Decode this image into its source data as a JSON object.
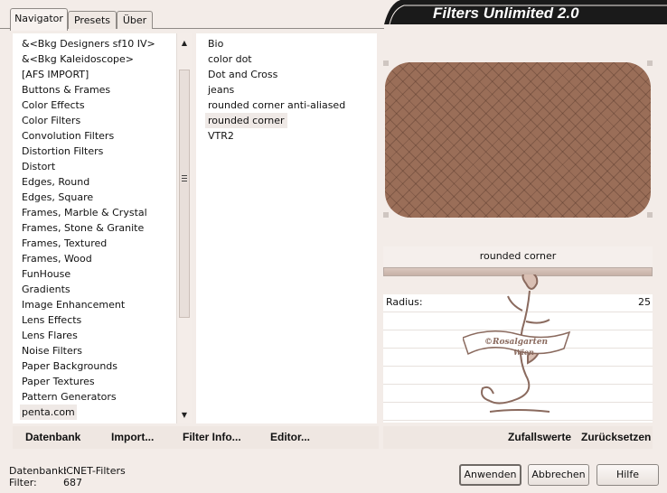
{
  "tabs": [
    {
      "label": "Navigator",
      "active": true
    },
    {
      "label": "Presets",
      "active": false
    },
    {
      "label": "Über",
      "active": false
    }
  ],
  "title": "Filters Unlimited 2.0",
  "categories": [
    "&<Bkg Designers sf10 IV>",
    "&<Bkg Kaleidoscope>",
    "[AFS IMPORT]",
    "Buttons & Frames",
    "Color Effects",
    "Color Filters",
    "Convolution Filters",
    "Distortion Filters",
    "Distort",
    "Edges, Round",
    "Edges, Square",
    "Frames, Marble & Crystal",
    "Frames, Stone & Granite",
    "Frames, Textured",
    "Frames, Wood",
    "FunHouse",
    "Gradients",
    "Image Enhancement",
    "Lens Effects",
    "Lens Flares",
    "Noise Filters",
    "Paper Backgrounds",
    "Paper Textures",
    "Pattern Generators",
    "penta.com"
  ],
  "selected_category": "penta.com",
  "filters": [
    "Bio",
    "color dot",
    "Dot and Cross",
    "jeans",
    "rounded corner anti-aliased",
    "rounded corner",
    "VTR2"
  ],
  "selected_filter": "rounded corner",
  "preview": {
    "filter_name": "rounded corner",
    "progress": 1.0
  },
  "params": [
    {
      "label": "Radius:",
      "value": "25"
    }
  ],
  "watermark": {
    "line1": "©Rosalgarten",
    "line2": "Wien"
  },
  "toolbar_left": {
    "database": "Datenbank",
    "import": "Import...",
    "filter_info": "Filter Info...",
    "editor": "Editor..."
  },
  "toolbar_right": {
    "random": "Zufallswerte",
    "reset": "Zurücksetzen"
  },
  "status": {
    "database_label": "Datenbank:",
    "database_value": "ICNET-Filters",
    "filter_label": "Filter:",
    "filter_value": "687"
  },
  "buttons": {
    "apply": "Anwenden",
    "cancel": "Abbrechen",
    "help": "Hilfe"
  },
  "colors": {
    "preview_fill": "#9a6e58",
    "banner_bg": "#1a1a1a",
    "watermark": "#8a6a5e"
  }
}
